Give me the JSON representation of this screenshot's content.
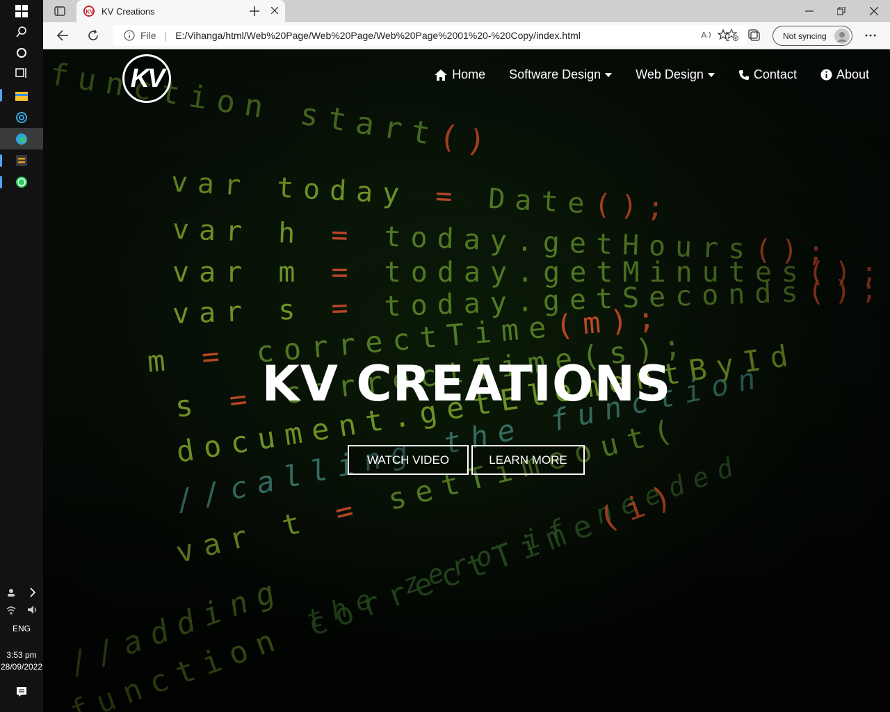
{
  "taskbar": {
    "language": "ENG",
    "time": "3:53 pm",
    "date": "28/09/2022"
  },
  "browser": {
    "tab_title": "KV Creations",
    "address_prefix": "File",
    "url": "E:/Vihanga/html/Web%20Page/Web%20Page/Web%20Page%2001%20-%20Copy/index.html",
    "sync_label": "Not syncing"
  },
  "site": {
    "logo_text": "KV",
    "nav": [
      {
        "label": "Home",
        "icon": "home-icon"
      },
      {
        "label": "Software Design",
        "icon": "caret-down-icon"
      },
      {
        "label": "Web Design",
        "icon": "caret-down-icon"
      },
      {
        "label": "Contact",
        "icon": "phone-icon"
      },
      {
        "label": "About",
        "icon": "info-icon"
      }
    ],
    "hero_title": "KV CREATIONS",
    "watch_video_label": "WATCH VIDEO",
    "learn_more_label": "LEARN MORE"
  }
}
